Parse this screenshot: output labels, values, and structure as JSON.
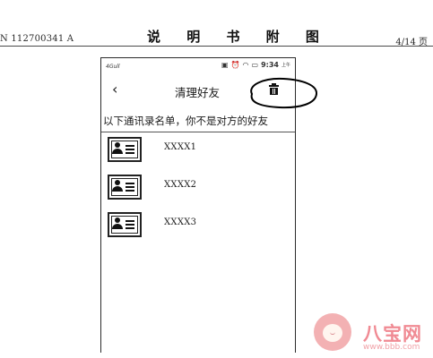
{
  "document": {
    "id_text": "N 112700341 A",
    "title": "说 明 书 附 图",
    "page": "4/14 页"
  },
  "phone": {
    "status_bar": {
      "signal": "4Gull",
      "time": "9:34",
      "ampm": "上午",
      "icons": [
        "sim-icon",
        "alarm-icon",
        "wifi-icon",
        "battery-icon"
      ]
    },
    "app_bar": {
      "back_icon": "‹",
      "title": "清理好友",
      "action_icon": "trash-icon"
    },
    "notice": "以下通讯录名单，你不是对方的好友",
    "contacts": [
      {
        "name": "XXXX1"
      },
      {
        "name": "XXXX2"
      },
      {
        "name": "XXXX3"
      }
    ]
  },
  "watermark": {
    "text": "八宝网",
    "url": "www.bbb.com"
  },
  "annotation": {
    "type": "hand-drawn ellipse around trash icon",
    "color": "#000000"
  }
}
